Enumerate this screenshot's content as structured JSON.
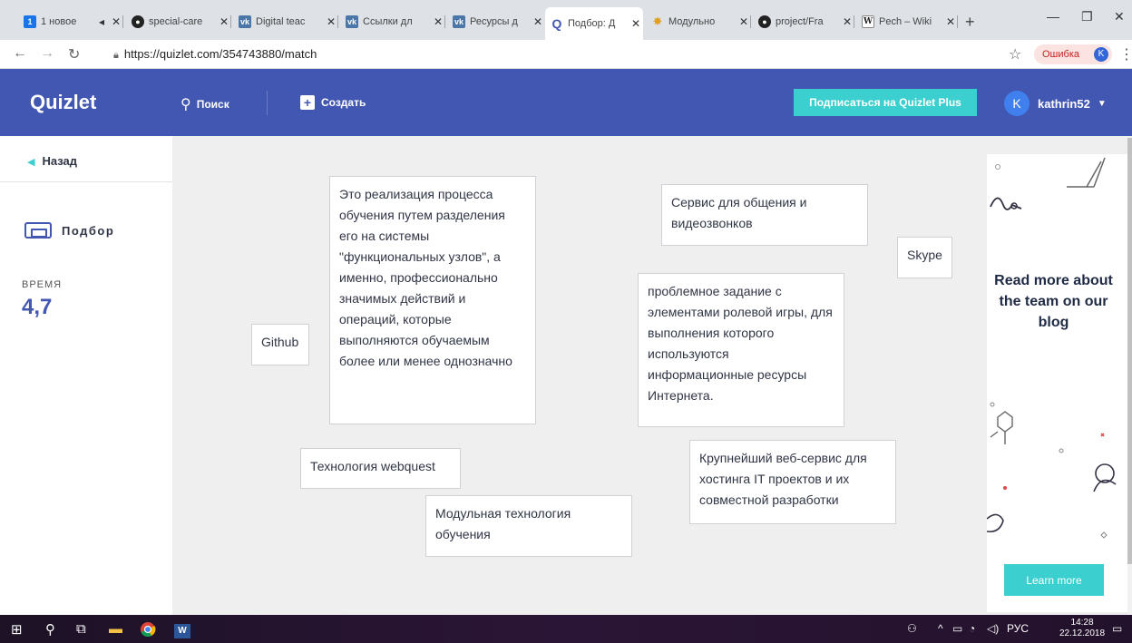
{
  "browser": {
    "tabs": [
      {
        "label": "1 новое",
        "icon": "vk-icon",
        "badge": "1"
      },
      {
        "label": "special-care",
        "icon": "github-icon"
      },
      {
        "label": "Digital teac",
        "icon": "vk-icon"
      },
      {
        "label": "Ссылки дл",
        "icon": "vk-icon"
      },
      {
        "label": "Ресурсы д",
        "icon": "vk-icon"
      },
      {
        "label": "Подбор: Д",
        "icon": "quizlet-icon"
      },
      {
        "label": "Модульно",
        "icon": "star-icon"
      },
      {
        "label": "project/Fra",
        "icon": "github-icon"
      },
      {
        "label": "Pech – Wiki",
        "icon": "wiki-icon"
      }
    ],
    "url": "https://quizlet.com/354743880/match",
    "error_label": "Ошибка",
    "profile_initial": "K"
  },
  "header": {
    "logo": "Quizlet",
    "search_label": "Поиск",
    "create_label": "Создать",
    "plus_button": "Подписаться на Quizlet Plus",
    "username": "kathrin52",
    "avatar_initial": "K"
  },
  "sidebar": {
    "back_label": "Назад",
    "mode_label": "Подбор",
    "time_label": "ВРЕМЯ",
    "time_value": "4,7"
  },
  "cards": [
    {
      "text": "Это реализация процесса обучения путем разделения его на системы \"функциональных узлов\", а именно, профессионально значимых действий и операций, которые выполняются обучаемым более или менее однозначно"
    },
    {
      "text": "Сервис для общения и видеозвонков"
    },
    {
      "text": "Skype"
    },
    {
      "text": "проблемное задание с элементами ролевой игры, для выполнения которого используются информационные ресурсы Интернета."
    },
    {
      "text": "Github"
    },
    {
      "text": "Крупнейший веб-сервис для хостинга IT проектов и их совместной разработки"
    },
    {
      "text": "Технология webquest"
    },
    {
      "text": "Модульная технология обучения"
    }
  ],
  "ad": {
    "text": "Read more about the team on our blog",
    "button": "Learn more"
  },
  "taskbar": {
    "lang": "РУС",
    "time": "14:28",
    "date": "22.12.2018"
  },
  "colors": {
    "brand": "#4257b2",
    "accent": "#3ccfcf"
  }
}
